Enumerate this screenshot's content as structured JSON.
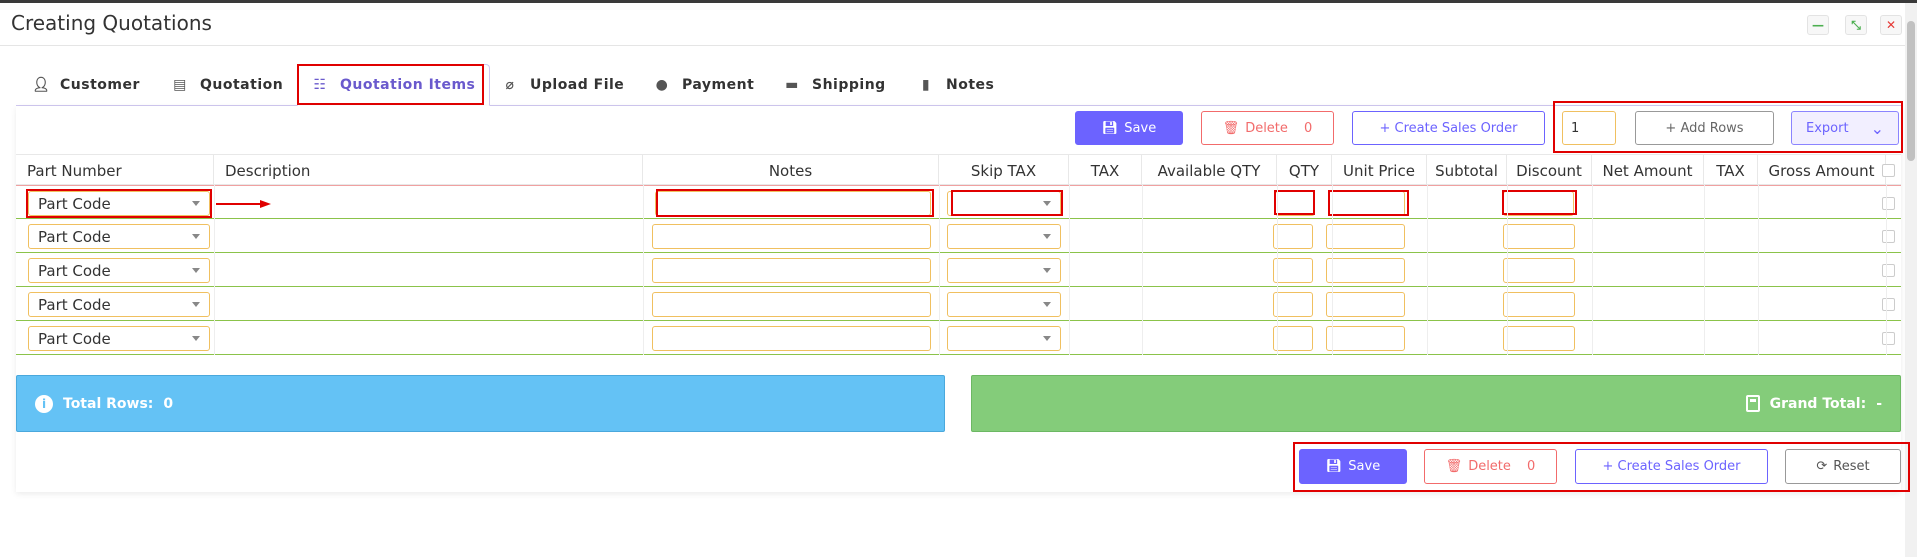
{
  "window": {
    "title": "Creating Quotations"
  },
  "tabs": [
    {
      "label": "Customer",
      "icon": "user-icon"
    },
    {
      "label": "Quotation",
      "icon": "document-icon"
    },
    {
      "label": "Quotation Items",
      "icon": "list-icon"
    },
    {
      "label": "Upload File",
      "icon": "paperclip-icon"
    },
    {
      "label": "Payment",
      "icon": "money-bag-icon"
    },
    {
      "label": "Shipping",
      "icon": "truck-icon"
    },
    {
      "label": "Notes",
      "icon": "notebook-icon"
    }
  ],
  "toolbar": {
    "save_label": "Save",
    "delete_label": "Delete",
    "delete_count": "0",
    "create_sales_order_label": "+ Create Sales Order",
    "rows_value": "1",
    "add_rows_label": "+ Add Rows",
    "export_label": "Export"
  },
  "table": {
    "headers": [
      "Part Number",
      "Description",
      "Notes",
      "Skip TAX",
      "TAX",
      "Available QTY",
      "QTY",
      "Unit Price",
      "Subtotal",
      "Discount",
      "Net Amount",
      "TAX",
      "Gross Amount"
    ],
    "rows": [
      {
        "part": "Part Code"
      },
      {
        "part": "Part Code"
      },
      {
        "part": "Part Code"
      },
      {
        "part": "Part Code"
      },
      {
        "part": "Part Code"
      }
    ]
  },
  "summary": {
    "total_rows_label": "Total Rows:",
    "total_rows_value": "0",
    "grand_total_label": "Grand Total:",
    "grand_total_value": "-"
  },
  "footer": {
    "save_label": "Save",
    "delete_label": "Delete",
    "delete_count": "0",
    "create_sales_order_label": "+ Create Sales Order",
    "reset_label": "Reset"
  },
  "colors": {
    "accent": "#6c63ff",
    "danger": "#f26b6b",
    "info": "#64c2f5",
    "success": "#84cc7a",
    "highlight": "#e00000"
  }
}
